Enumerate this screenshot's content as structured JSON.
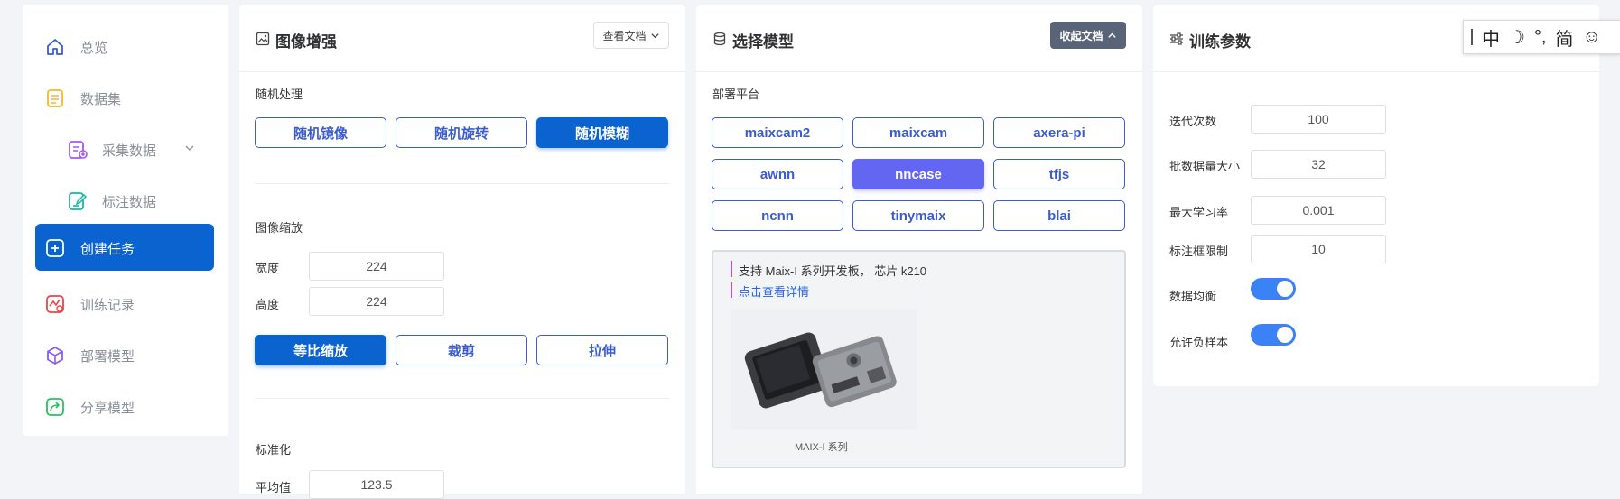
{
  "sidebar": {
    "items": [
      {
        "label": "总览",
        "icon": "home-icon"
      },
      {
        "label": "数据集",
        "icon": "dataset-icon"
      },
      {
        "label": "采集数据",
        "icon": "collect-data-icon"
      },
      {
        "label": "标注数据",
        "icon": "annotate-icon"
      },
      {
        "label": "创建任务",
        "icon": "plus-square-icon"
      },
      {
        "label": "训练记录",
        "icon": "training-chart-icon"
      },
      {
        "label": "部署模型",
        "icon": "cube-icon"
      },
      {
        "label": "分享模型",
        "icon": "share-icon"
      }
    ]
  },
  "augment": {
    "title": "图像增强",
    "doc_button": "查看文档",
    "random_label": "随机处理",
    "random_buttons": [
      "随机镜像",
      "随机旋转",
      "随机模糊"
    ],
    "scale_label": "图像缩放",
    "width_label": "宽度",
    "width_value": "224",
    "height_label": "高度",
    "height_value": "224",
    "scale_buttons": [
      "等比缩放",
      "裁剪",
      "拉伸"
    ],
    "normalize_label": "标准化",
    "mean_label": "平均值",
    "mean_value": "123.5"
  },
  "model": {
    "title": "选择模型",
    "collapse_button": "收起文档",
    "platform_label": "部署平台",
    "platforms": [
      "maixcam2",
      "maixcam",
      "axera-pi",
      "awnn",
      "nncase",
      "tfjs",
      "ncnn",
      "tinymaix",
      "blai"
    ],
    "selected_platform": "nncase",
    "info_line": "支持 Maix-I 系列开发板， 芯片 k210",
    "info_link": "点击查看详情",
    "image_caption": "MAIX-I 系列"
  },
  "train": {
    "title": "训练参数",
    "epochs_label": "迭代次数",
    "epochs_value": "100",
    "batch_label": "批数据量大小",
    "batch_value": "32",
    "lr_label": "最大学习率",
    "lr_value": "0.001",
    "bbox_label": "标注框限制",
    "bbox_value": "10",
    "balance_label": "数据均衡",
    "balance_on": true,
    "negative_label": "允许负样本",
    "negative_on": true
  },
  "ime": {
    "items": [
      "中",
      "☽",
      "°,",
      "简",
      "☺"
    ]
  },
  "colors": {
    "primary": "#0a63cf",
    "selected_platform": "#6366f1",
    "outline": "#3b5ccf"
  }
}
